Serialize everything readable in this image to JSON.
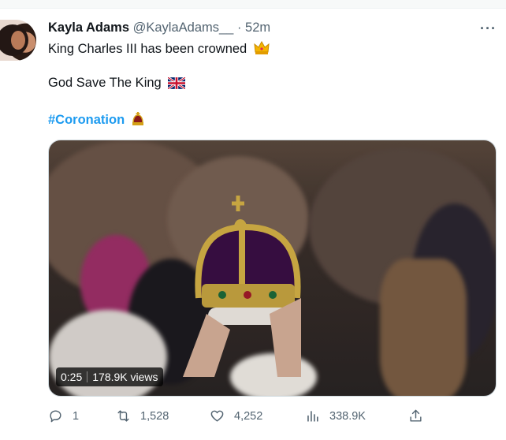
{
  "tweet": {
    "author_name": "Kayla Adams",
    "author_handle": "@KaylaAdams__",
    "separator": "·",
    "time": "52m",
    "more_label": "···",
    "line1": "King Charles III has been crowned",
    "line2": "God Save The King",
    "hashtag": "#Coronation"
  },
  "video": {
    "duration": "0:25",
    "views": "178.9K views"
  },
  "actions": {
    "replies": "1",
    "retweets": "1,528",
    "likes": "4,252",
    "views": "338.9K"
  },
  "icons": {
    "line1": "crown-emoji-icon",
    "line2": "uk-flag-emoji-icon",
    "line3": "crown-emoji-icon"
  },
  "colors": {
    "link": "#1d9bf0",
    "muted": "#536471",
    "text": "#0f1419"
  }
}
